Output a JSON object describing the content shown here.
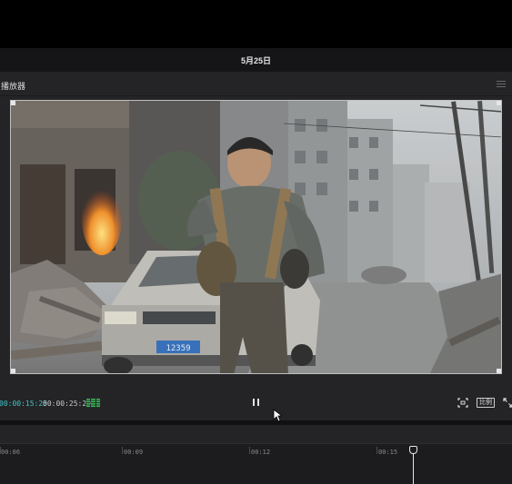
{
  "window": {
    "date_title": "5月25日"
  },
  "player": {
    "title": "播放器",
    "menu_icon": "hamburger-menu-icon",
    "current_time": "00:00:15:25",
    "total_time": "00:00:25:29",
    "playback_state": "playing",
    "ratio_label": "比例",
    "license_plate": "12359"
  },
  "timeline": {
    "ticks": [
      "00:06",
      "00:09",
      "00:12",
      "00:15"
    ]
  },
  "colors": {
    "accent_timecode": "#3fc6c6",
    "audio_meter": "#3bb55a",
    "panel_bg": "#242427"
  }
}
